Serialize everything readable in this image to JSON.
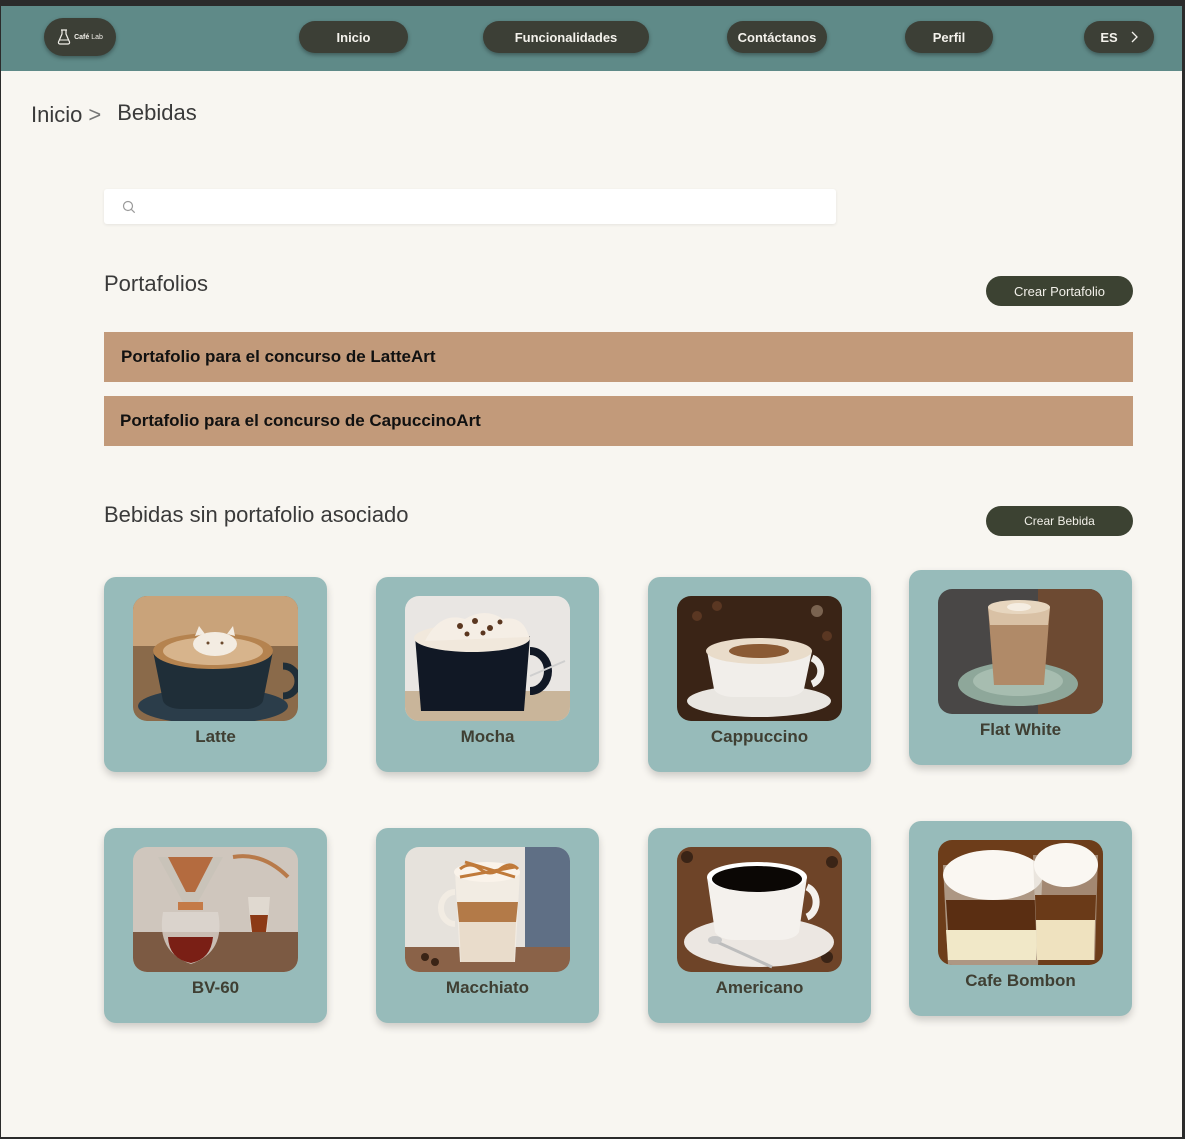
{
  "nav": {
    "logo_text_bold": "Café",
    "logo_text_light": "Lab",
    "items": [
      "Inicio",
      "Funcionalidades",
      "Contáctanos",
      "Perfil"
    ],
    "language": "ES"
  },
  "breadcrumb": {
    "home": "Inicio",
    "separator": ">",
    "current": "Bebidas"
  },
  "search": {
    "placeholder": ""
  },
  "portfolios": {
    "title": "Portafolios",
    "create_label": "Crear Portafolio",
    "items": [
      "Portafolio para el concurso de LatteArt",
      "Portafolio para el concurso de CapuccinoArt"
    ]
  },
  "drinks": {
    "title": "Bebidas sin portafolio asociado",
    "create_label": "Crear Bebida",
    "items": [
      {
        "name": "Latte"
      },
      {
        "name": "Mocha"
      },
      {
        "name": "Cappuccino"
      },
      {
        "name": "Flat White"
      },
      {
        "name": "BV-60"
      },
      {
        "name": "Macchiato"
      },
      {
        "name": "Americano"
      },
      {
        "name": "Cafe Bombon"
      }
    ]
  },
  "colors": {
    "topbar": "#5f8a88",
    "button_dark": "#3c3f36",
    "portfolio_bar": "#c29a7a",
    "card": "#97bbba",
    "page_bg": "#f8f6f1"
  }
}
